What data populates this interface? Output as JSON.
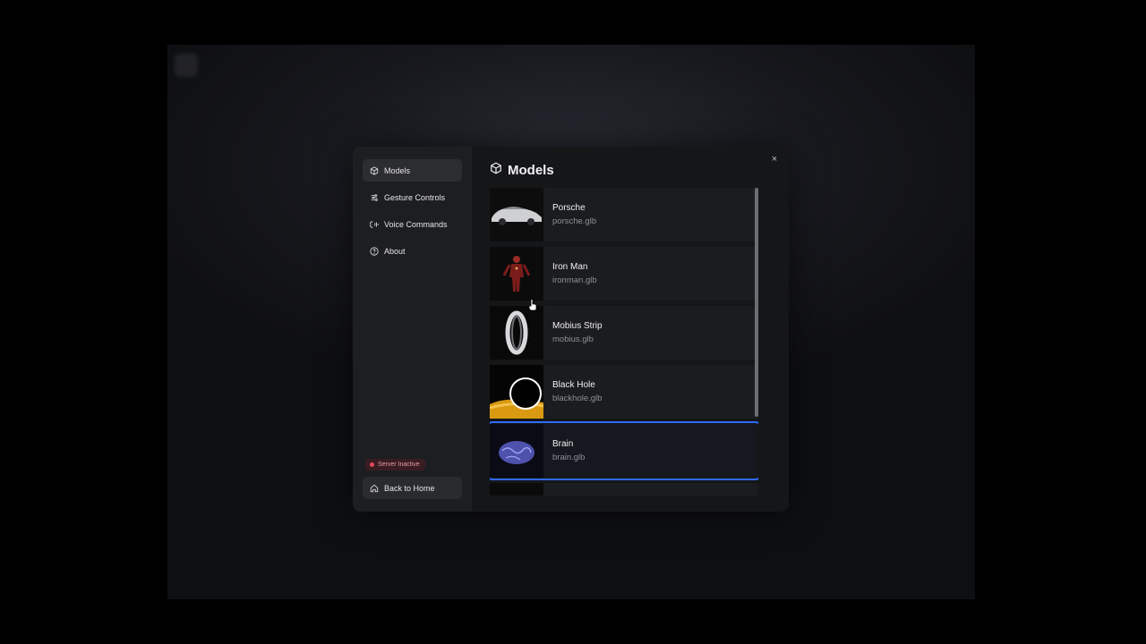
{
  "sidebar": {
    "items": [
      {
        "label": "Models",
        "icon": "cube-icon",
        "active": true
      },
      {
        "label": "Gesture Controls",
        "icon": "sliders-icon",
        "active": false
      },
      {
        "label": "Voice Commands",
        "icon": "voice-icon",
        "active": false
      },
      {
        "label": "About",
        "icon": "help-circle-icon",
        "active": false
      }
    ],
    "server_status": "Server Inactive",
    "back_label": "Back to Home"
  },
  "main": {
    "title": "Models",
    "close_symbol": "×",
    "models": [
      {
        "name": "Porsche",
        "file": "porsche.glb"
      },
      {
        "name": "Iron Man",
        "file": "ironman.glb"
      },
      {
        "name": "Mobius Strip",
        "file": "mobius.glb"
      },
      {
        "name": "Black Hole",
        "file": "blackhole.glb"
      },
      {
        "name": "Brain",
        "file": "brain.glb",
        "selected": true
      }
    ]
  },
  "colors": {
    "accent": "#2f6bff",
    "server_inactive": "#e5485d"
  }
}
